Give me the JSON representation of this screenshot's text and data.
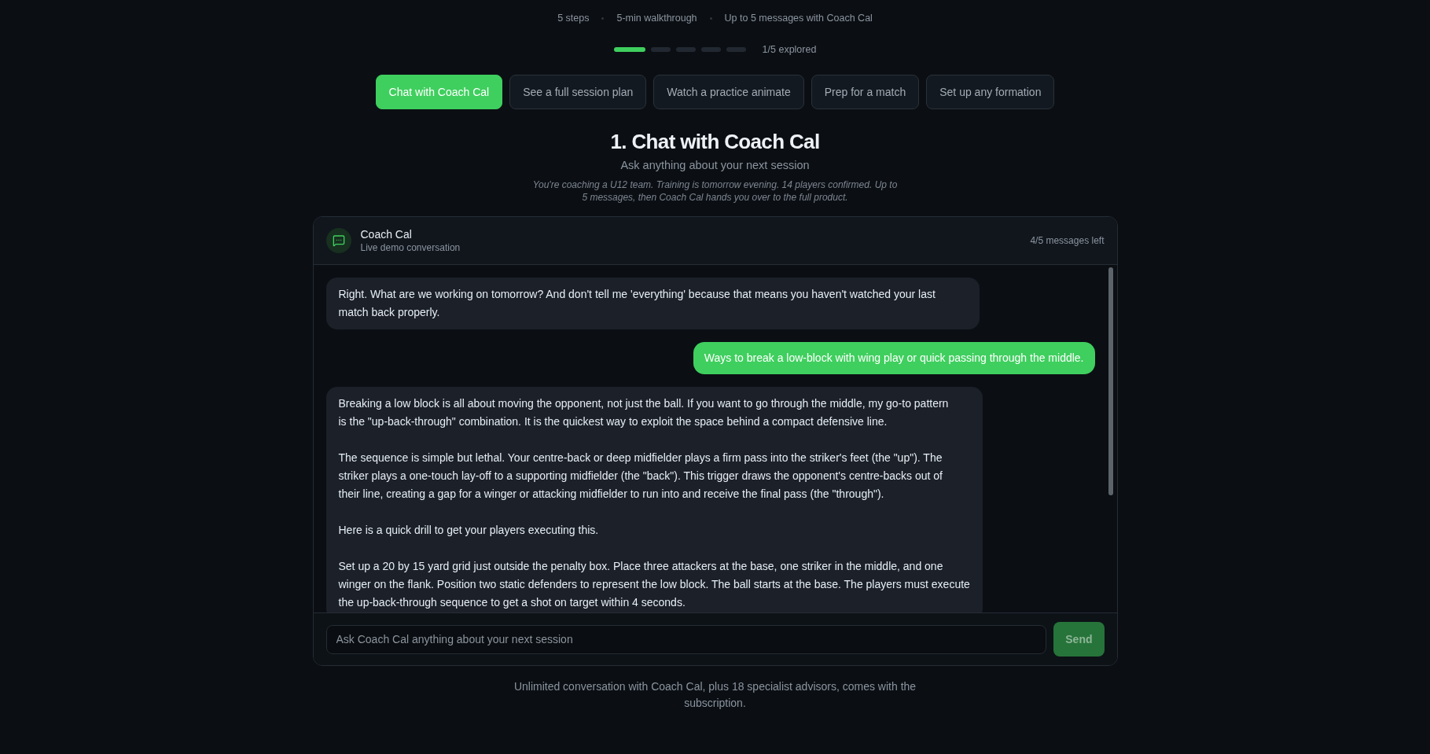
{
  "meta": {
    "items": [
      "5 steps",
      "5-min walkthrough",
      "Up to 5 messages with Coach Cal"
    ]
  },
  "progress": {
    "segments": [
      {
        "filled": true
      },
      {
        "filled": false
      },
      {
        "filled": false
      },
      {
        "filled": false
      },
      {
        "filled": false
      }
    ],
    "label": "1/5 explored"
  },
  "tabs": [
    {
      "label": "Chat with Coach Cal",
      "selected": true
    },
    {
      "label": "See a full session plan",
      "selected": false
    },
    {
      "label": "Watch a practice animate",
      "selected": false
    },
    {
      "label": "Prep for a match",
      "selected": false
    },
    {
      "label": "Set up any formation",
      "selected": false
    }
  ],
  "section": {
    "title": "1. Chat with Coach Cal",
    "subtitle": "Ask anything about your next session",
    "scenario": "You're coaching a U12 team. Training is tomorrow evening. 14 players confirmed. Up to 5 messages, then Coach Cal hands you over to the full product."
  },
  "chat": {
    "header": {
      "name": "Coach Cal",
      "status": "Live demo conversation",
      "remaining": "4/5 messages left"
    },
    "messages": [
      {
        "kind": "coach",
        "paragraphs": [
          [
            "Right. What are we working on tomorrow? And don't tell me 'everything' because that means you haven't watched your last",
            "match back properly."
          ]
        ]
      },
      {
        "kind": "user",
        "paragraphs": [
          [
            "Ways to break a low-block with wing play or quick passing through the middle."
          ]
        ]
      },
      {
        "kind": "coach",
        "paragraphs": [
          [
            "Breaking a low block is all about moving the opponent, not just the ball. If you want to go through the middle, my go-to pattern",
            "is the \"up-back-through\" combination. It is the quickest way to exploit the space behind a compact defensive line."
          ],
          [
            "The sequence is simple but lethal. Your centre-back or deep midfielder plays a firm pass into the striker's feet (the \"up\"). The",
            "striker plays a one-touch lay-off to a supporting midfielder (the \"back\"). This trigger draws the opponent's centre-backs out of",
            "their line, creating a gap for a winger or attacking midfielder to run into and receive the final pass (the \"through\")."
          ],
          [
            "Here is a quick drill to get your players executing this."
          ],
          [
            "Set up a 20 by 15 yard grid just outside the penalty box. Place three attackers at the base, one striker in the middle, and one",
            "winger on the flank. Position two static defenders to represent the low block. The ball starts at the base. The players must execute",
            "the up-back-through sequence to get a shot on target within 4 seconds."
          ]
        ]
      }
    ],
    "composer": {
      "placeholder": "Ask Coach Cal anything about your next session",
      "send": {
        "label": "Send",
        "disabled": true
      }
    }
  },
  "footer_note": "Unlimited conversation with Coach Cal, plus 18 specialist advisors, comes with the subscription."
}
